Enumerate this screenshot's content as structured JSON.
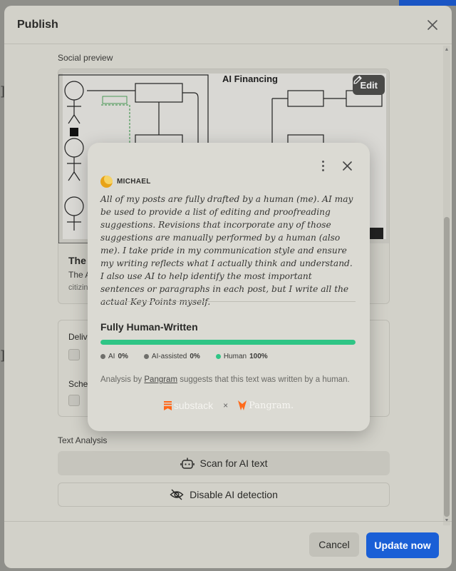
{
  "dialog": {
    "title": "Publish",
    "social_preview_label": "Social preview",
    "preview": {
      "image_title": "AI Financing",
      "edit_label": "Edit",
      "title": "The A",
      "subtitle": "The A",
      "domain": "citizin"
    },
    "delivery": {
      "delivery_label": "Deliv",
      "schedule_label": "Sche"
    },
    "text_analysis_label": "Text Analysis",
    "scan_button": "Scan for AI text",
    "disable_button": "Disable AI detection",
    "cancel_button": "Cancel",
    "update_button": "Update now"
  },
  "popup": {
    "author": "MICHAEL",
    "statement": "All of my posts are fully drafted by a human (me). AI may be used to provide a list of editing and proofreading suggestions. Revisions that incorporate any of those suggestions are manually performed by a human (also me). I take pride in my communication style and ensure my writing reflects what I actually think and understand. I also use AI to help identify the most important sentences or paragraphs in each post, but I write all the actual Key Points myself.",
    "verdict": "Fully Human-Written",
    "human_fraction": 1.0,
    "legend": [
      {
        "label": "AI",
        "value": "0%",
        "color": "#6f6f6b"
      },
      {
        "label": "AI-assisted",
        "value": "0%",
        "color": "#6f6f6b"
      },
      {
        "label": "Human",
        "value": "100%",
        "color": "#2fc585"
      }
    ],
    "analysis_prefix": "Analysis by",
    "analysis_link": "Pangram",
    "analysis_suffix": "suggests that this text was written by a human.",
    "brand_left": "substack",
    "brand_x": "×",
    "brand_right": "Pangram."
  },
  "colors": {
    "primary": "#1a5fd6",
    "human_green": "#2fc585",
    "substack_orange": "#ff6719",
    "pangram_orange": "#ff6a1a"
  }
}
